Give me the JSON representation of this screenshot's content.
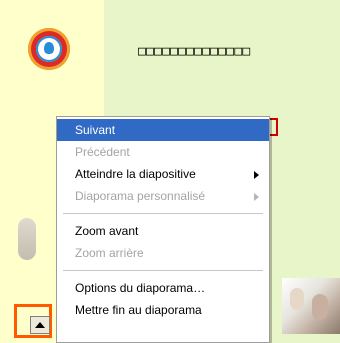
{
  "slide": {
    "title_text": "□□□□□□□□□□□□□□",
    "colors": {
      "slide_bg": "#ffffff",
      "slide_left_bg": "#ffffcc",
      "slide_right_bg": "#e8f5c8",
      "accent_orange": "#ff5a00",
      "selection_blue": "#316ac5"
    }
  },
  "menu": {
    "items": [
      {
        "label": "Suivant",
        "state": "selected",
        "has_submenu": false
      },
      {
        "label": "Précédent",
        "state": "disabled",
        "has_submenu": false
      },
      {
        "label": "Atteindre la diapositive",
        "state": "enabled",
        "has_submenu": true
      },
      {
        "label": "Diaporama personnalisé",
        "state": "disabled",
        "has_submenu": true
      },
      {
        "label": "Zoom avant",
        "state": "enabled",
        "has_submenu": false
      },
      {
        "label": "Zoom arrière",
        "state": "disabled",
        "has_submenu": false
      },
      {
        "label": "Options du diaporama…",
        "state": "enabled",
        "has_submenu": false
      },
      {
        "label": "Mettre fin au diaporama",
        "state": "enabled",
        "has_submenu": false
      }
    ]
  },
  "icons": {
    "logo": "organization-logo-icon",
    "popup_trigger": "triangle-up-icon",
    "submenu": "chevron-right-icon"
  }
}
